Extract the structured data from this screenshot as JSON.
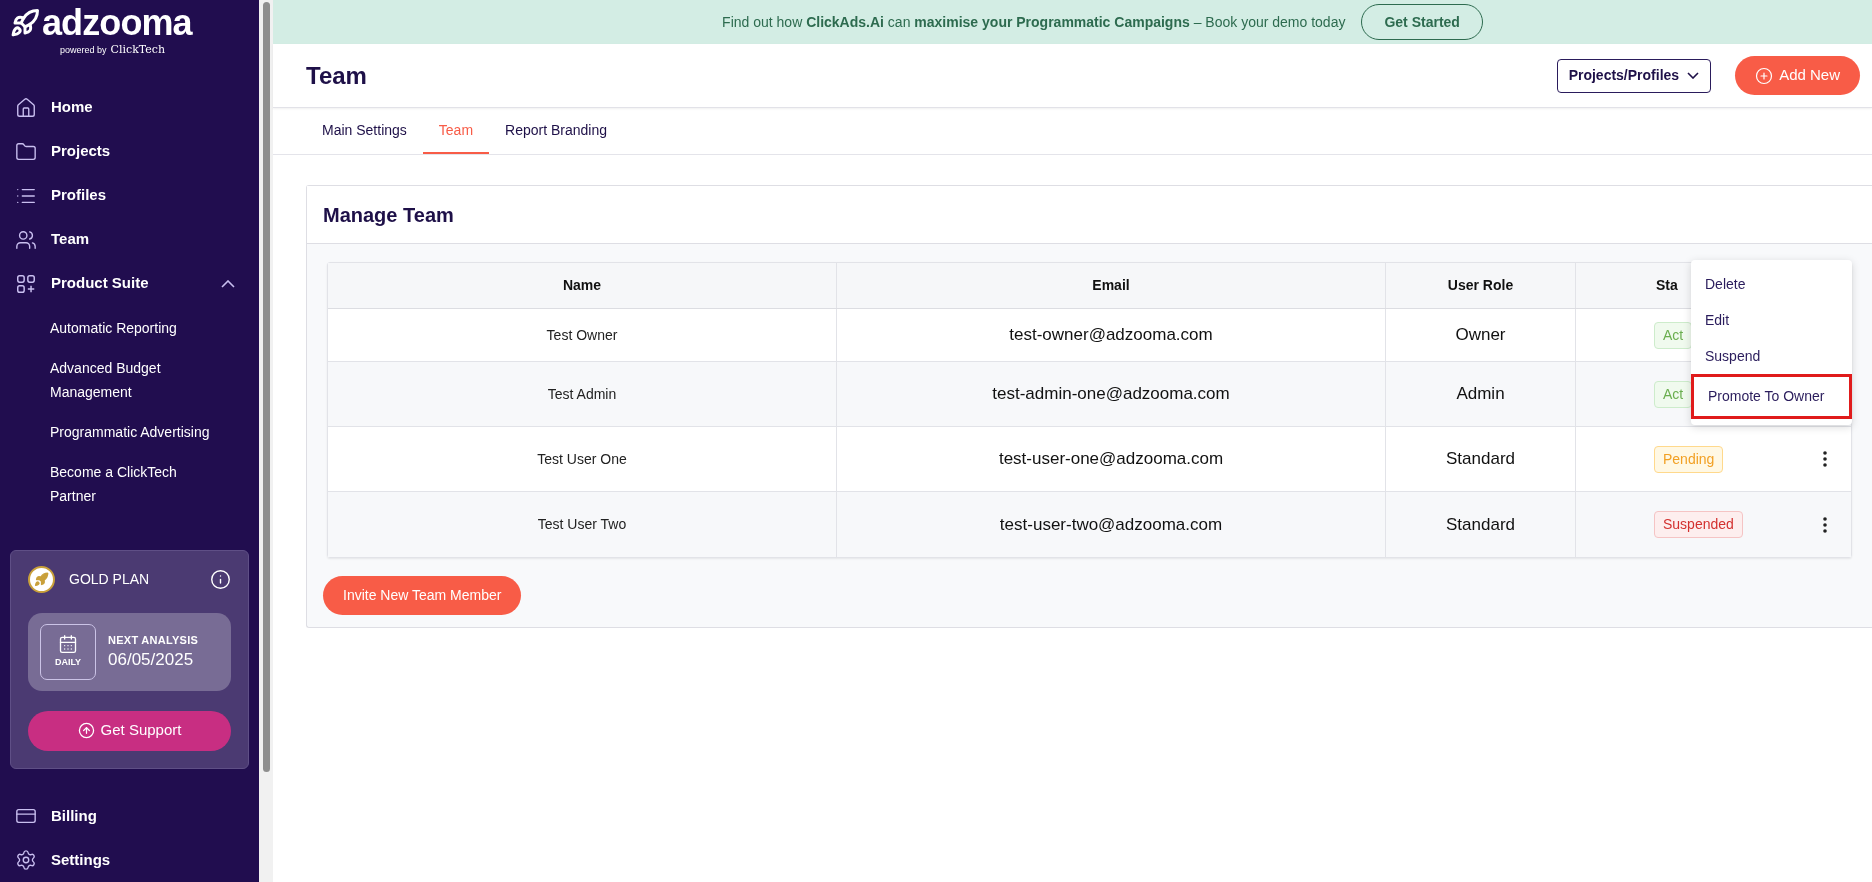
{
  "sidebar": {
    "logo": {
      "name": "adzooma",
      "powered_by": "powered by",
      "brand": "ClickTech"
    },
    "items": [
      {
        "label": "Home"
      },
      {
        "label": "Projects"
      },
      {
        "label": "Profiles"
      },
      {
        "label": "Team"
      },
      {
        "label": "Product Suite",
        "expanded": true,
        "children": [
          {
            "label": "Automatic Reporting"
          },
          {
            "label": "Advanced Budget Management"
          },
          {
            "label": "Programmatic Advertising"
          },
          {
            "label": "Become a ClickTech Partner"
          }
        ]
      }
    ],
    "plan": {
      "title": "GOLD PLAN",
      "frequency": "DAILY",
      "next_label": "NEXT ANALYSIS",
      "next_date": "06/05/2025",
      "support_button": "Get Support"
    },
    "bottom_items": [
      {
        "label": "Billing"
      },
      {
        "label": "Settings"
      }
    ]
  },
  "banner": {
    "text": "Find out how **ClickAds.Ai** can **maximise your Programmatic Campaigns** – Book your demo today",
    "button": "Get Started"
  },
  "header": {
    "title": "Team",
    "dropdown": "Projects/Profiles",
    "add_button": "Add New"
  },
  "tabs": [
    {
      "label": "Main Settings",
      "selected": false
    },
    {
      "label": "Team",
      "selected": true
    },
    {
      "label": "Report Branding",
      "selected": false
    }
  ],
  "card": {
    "title": "Manage Team",
    "invite_button": "Invite New Team Member"
  },
  "table": {
    "columns": [
      "Name",
      "Email",
      "User Role",
      "Sta"
    ],
    "rows": [
      {
        "name": "Test Owner",
        "email": "test-owner@adzooma.com",
        "role": "Owner",
        "status": "Act",
        "kind": "active",
        "menu_button": false
      },
      {
        "name": "Test Admin",
        "email": "test-admin-one@adzooma.com",
        "role": "Admin",
        "status": "Act",
        "kind": "active",
        "menu_button": false
      },
      {
        "name": "Test User One",
        "email": "test-user-one@adzooma.com",
        "role": "Standard",
        "status": "Pending",
        "kind": "pending",
        "menu_button": true
      },
      {
        "name": "Test User Two",
        "email": "test-user-two@adzooma.com",
        "role": "Standard",
        "status": "Suspended",
        "kind": "suspended",
        "menu_button": true
      }
    ]
  },
  "row_menu": {
    "items": [
      {
        "label": "Delete",
        "highlighted": false
      },
      {
        "label": "Edit",
        "highlighted": false
      },
      {
        "label": "Suspend",
        "highlighted": false
      },
      {
        "label": "Promote To Owner",
        "highlighted": true
      }
    ]
  }
}
